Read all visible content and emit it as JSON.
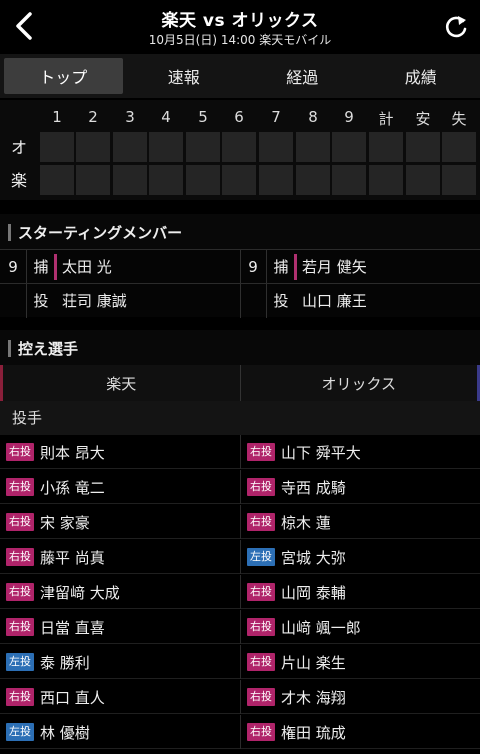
{
  "header": {
    "title": "楽天 vs オリックス",
    "subtitle": "10月5日(日) 14:00 楽天モバイル",
    "back_icon": "chevron-left-icon",
    "refresh_icon": "refresh-icon"
  },
  "tabs": [
    "トップ",
    "速報",
    "経過",
    "成績"
  ],
  "scoreboard": {
    "headers": [
      "1",
      "2",
      "3",
      "4",
      "5",
      "6",
      "7",
      "8",
      "9",
      "計",
      "安",
      "失"
    ],
    "teams": [
      "オ",
      "楽"
    ]
  },
  "starting": {
    "title": "スターティングメンバー",
    "rows": [
      {
        "left": {
          "num": "9",
          "pos": "捕",
          "name": "太田 光"
        },
        "right": {
          "num": "9",
          "pos": "捕",
          "name": "若月 健矢"
        }
      },
      {
        "left": {
          "num": "",
          "pos": "投",
          "name": "荘司 康誠"
        },
        "right": {
          "num": "",
          "pos": "投",
          "name": "山口 廉王"
        }
      }
    ]
  },
  "bench": {
    "title": "控え選手",
    "team_left": "楽天",
    "team_right": "オリックス",
    "subsection": "投手",
    "rows": [
      {
        "l_badge": "右投",
        "l_name": "則本 昂大",
        "r_badge": "右投",
        "r_name": "山下 舜平大"
      },
      {
        "l_badge": "右投",
        "l_name": "小孫 竜二",
        "r_badge": "右投",
        "r_name": "寺西 成騎"
      },
      {
        "l_badge": "右投",
        "l_name": "宋 家豪",
        "r_badge": "右投",
        "r_name": "椋木 蓮"
      },
      {
        "l_badge": "右投",
        "l_name": "藤平 尚真",
        "r_badge": "左投",
        "r_name": "宮城 大弥"
      },
      {
        "l_badge": "右投",
        "l_name": "津留﨑 大成",
        "r_badge": "右投",
        "r_name": "山岡 泰輔"
      },
      {
        "l_badge": "右投",
        "l_name": "日當 直喜",
        "r_badge": "右投",
        "r_name": "山﨑 颯一郎"
      },
      {
        "l_badge": "左投",
        "l_name": "泰 勝利",
        "r_badge": "右投",
        "r_name": "片山 楽生"
      },
      {
        "l_badge": "右投",
        "l_name": "西口 直人",
        "r_badge": "右投",
        "r_name": "才木 海翔"
      },
      {
        "l_badge": "左投",
        "l_name": "林 優樹",
        "r_badge": "右投",
        "r_name": "権田 琉成"
      }
    ]
  },
  "colors": {
    "right_handed": "#b0246a",
    "left_handed": "#2c6fb5",
    "home_accent": "#8a1f3a",
    "away_accent": "#3a3a8a"
  }
}
